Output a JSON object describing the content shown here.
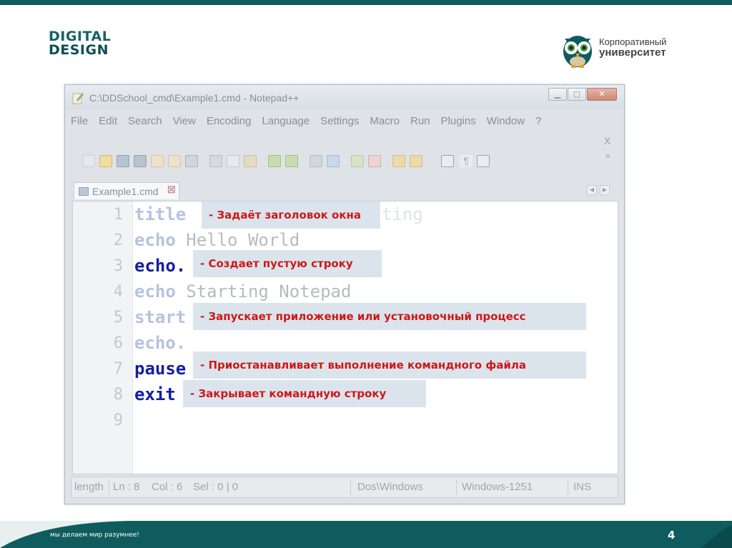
{
  "logos": {
    "digital_design": {
      "line1": "DIGITAL",
      "line2": "DESIGN"
    },
    "corporate_university": {
      "line1": "Корпоративный",
      "line2": "университет"
    }
  },
  "window": {
    "title": "C:\\DDSchool_cmd\\Example1.cmd - Notepad++",
    "menu": [
      "File",
      "Edit",
      "Search",
      "View",
      "Encoding",
      "Language",
      "Settings",
      "Macro",
      "Run",
      "Plugins",
      "Window",
      "?"
    ],
    "menu_close": "X",
    "tab": {
      "label": "Example1.cmd",
      "close": "☒"
    },
    "toolbar_overflow": "»"
  },
  "editor": {
    "line_numbers": [
      "1",
      "2",
      "3",
      "4",
      "5",
      "6",
      "7",
      "8",
      "9"
    ],
    "lines": [
      {
        "keyword": "title",
        "text": ""
      },
      {
        "keyword": "echo",
        "text": " Hello World"
      },
      {
        "keyword": "echo.",
        "text": ""
      },
      {
        "keyword": "echo",
        "text": " Starting Notepad"
      },
      {
        "keyword": "start",
        "text": ""
      },
      {
        "keyword": "echo.",
        "text": ""
      },
      {
        "keyword": "pause",
        "text": ""
      },
      {
        "keyword": "exit",
        "text": ""
      }
    ],
    "ghost_text": "ting"
  },
  "annotations": [
    "- Задаёт заголовок окна",
    "- Создает пустую строку",
    "- Запускает приложение или установочный процесс",
    "- Приостанавливает выполнение командного файла",
    "- Закрывает командную строку"
  ],
  "statusbar": {
    "length": "length",
    "ln": "Ln : 8",
    "col": "Col : 6",
    "sel": "Sel : 0 | 0",
    "eol": "Dos\\Windows",
    "encoding": "Windows-1251",
    "mode": "INS"
  },
  "footer": {
    "slogan": "мы делаем мир разумнее!",
    "page": "4"
  },
  "colors": {
    "teal": "#0f5c5e",
    "annotation_text": "#d01717",
    "annotation_bg": "#dbe4ec",
    "keyword_dark": "#141f9e"
  }
}
